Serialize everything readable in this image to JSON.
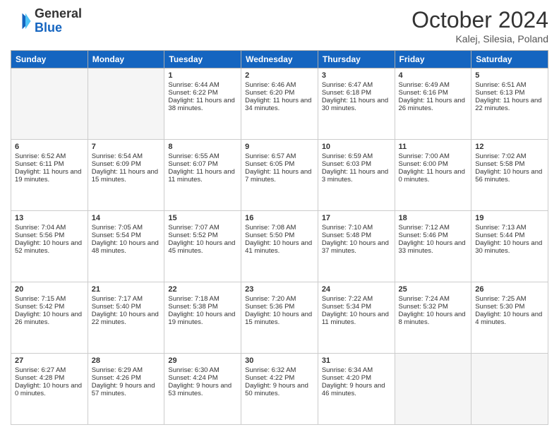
{
  "header": {
    "logo_line1": "General",
    "logo_line2": "Blue",
    "month": "October 2024",
    "location": "Kalej, Silesia, Poland"
  },
  "days_of_week": [
    "Sunday",
    "Monday",
    "Tuesday",
    "Wednesday",
    "Thursday",
    "Friday",
    "Saturday"
  ],
  "weeks": [
    [
      {
        "day": "",
        "info": ""
      },
      {
        "day": "",
        "info": ""
      },
      {
        "day": "1",
        "info": "Sunrise: 6:44 AM\nSunset: 6:22 PM\nDaylight: 11 hours and 38 minutes."
      },
      {
        "day": "2",
        "info": "Sunrise: 6:46 AM\nSunset: 6:20 PM\nDaylight: 11 hours and 34 minutes."
      },
      {
        "day": "3",
        "info": "Sunrise: 6:47 AM\nSunset: 6:18 PM\nDaylight: 11 hours and 30 minutes."
      },
      {
        "day": "4",
        "info": "Sunrise: 6:49 AM\nSunset: 6:16 PM\nDaylight: 11 hours and 26 minutes."
      },
      {
        "day": "5",
        "info": "Sunrise: 6:51 AM\nSunset: 6:13 PM\nDaylight: 11 hours and 22 minutes."
      }
    ],
    [
      {
        "day": "6",
        "info": "Sunrise: 6:52 AM\nSunset: 6:11 PM\nDaylight: 11 hours and 19 minutes."
      },
      {
        "day": "7",
        "info": "Sunrise: 6:54 AM\nSunset: 6:09 PM\nDaylight: 11 hours and 15 minutes."
      },
      {
        "day": "8",
        "info": "Sunrise: 6:55 AM\nSunset: 6:07 PM\nDaylight: 11 hours and 11 minutes."
      },
      {
        "day": "9",
        "info": "Sunrise: 6:57 AM\nSunset: 6:05 PM\nDaylight: 11 hours and 7 minutes."
      },
      {
        "day": "10",
        "info": "Sunrise: 6:59 AM\nSunset: 6:03 PM\nDaylight: 11 hours and 3 minutes."
      },
      {
        "day": "11",
        "info": "Sunrise: 7:00 AM\nSunset: 6:00 PM\nDaylight: 11 hours and 0 minutes."
      },
      {
        "day": "12",
        "info": "Sunrise: 7:02 AM\nSunset: 5:58 PM\nDaylight: 10 hours and 56 minutes."
      }
    ],
    [
      {
        "day": "13",
        "info": "Sunrise: 7:04 AM\nSunset: 5:56 PM\nDaylight: 10 hours and 52 minutes."
      },
      {
        "day": "14",
        "info": "Sunrise: 7:05 AM\nSunset: 5:54 PM\nDaylight: 10 hours and 48 minutes."
      },
      {
        "day": "15",
        "info": "Sunrise: 7:07 AM\nSunset: 5:52 PM\nDaylight: 10 hours and 45 minutes."
      },
      {
        "day": "16",
        "info": "Sunrise: 7:08 AM\nSunset: 5:50 PM\nDaylight: 10 hours and 41 minutes."
      },
      {
        "day": "17",
        "info": "Sunrise: 7:10 AM\nSunset: 5:48 PM\nDaylight: 10 hours and 37 minutes."
      },
      {
        "day": "18",
        "info": "Sunrise: 7:12 AM\nSunset: 5:46 PM\nDaylight: 10 hours and 33 minutes."
      },
      {
        "day": "19",
        "info": "Sunrise: 7:13 AM\nSunset: 5:44 PM\nDaylight: 10 hours and 30 minutes."
      }
    ],
    [
      {
        "day": "20",
        "info": "Sunrise: 7:15 AM\nSunset: 5:42 PM\nDaylight: 10 hours and 26 minutes."
      },
      {
        "day": "21",
        "info": "Sunrise: 7:17 AM\nSunset: 5:40 PM\nDaylight: 10 hours and 22 minutes."
      },
      {
        "day": "22",
        "info": "Sunrise: 7:18 AM\nSunset: 5:38 PM\nDaylight: 10 hours and 19 minutes."
      },
      {
        "day": "23",
        "info": "Sunrise: 7:20 AM\nSunset: 5:36 PM\nDaylight: 10 hours and 15 minutes."
      },
      {
        "day": "24",
        "info": "Sunrise: 7:22 AM\nSunset: 5:34 PM\nDaylight: 10 hours and 11 minutes."
      },
      {
        "day": "25",
        "info": "Sunrise: 7:24 AM\nSunset: 5:32 PM\nDaylight: 10 hours and 8 minutes."
      },
      {
        "day": "26",
        "info": "Sunrise: 7:25 AM\nSunset: 5:30 PM\nDaylight: 10 hours and 4 minutes."
      }
    ],
    [
      {
        "day": "27",
        "info": "Sunrise: 6:27 AM\nSunset: 4:28 PM\nDaylight: 10 hours and 0 minutes."
      },
      {
        "day": "28",
        "info": "Sunrise: 6:29 AM\nSunset: 4:26 PM\nDaylight: 9 hours and 57 minutes."
      },
      {
        "day": "29",
        "info": "Sunrise: 6:30 AM\nSunset: 4:24 PM\nDaylight: 9 hours and 53 minutes."
      },
      {
        "day": "30",
        "info": "Sunrise: 6:32 AM\nSunset: 4:22 PM\nDaylight: 9 hours and 50 minutes."
      },
      {
        "day": "31",
        "info": "Sunrise: 6:34 AM\nSunset: 4:20 PM\nDaylight: 9 hours and 46 minutes."
      },
      {
        "day": "",
        "info": ""
      },
      {
        "day": "",
        "info": ""
      }
    ]
  ]
}
